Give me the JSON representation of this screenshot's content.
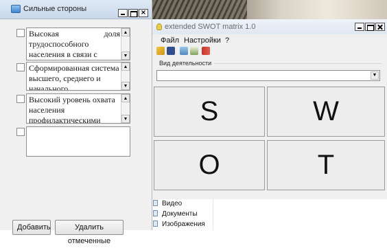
{
  "strengths_window": {
    "title": "Сильные стороны",
    "items": [
      {
        "text": "Высокая доля трудоспособного населения в связи с"
      },
      {
        "text": "Сформированная система высшего, среднего и начального"
      },
      {
        "text": "Высокий уровень охвата населения профилактическими"
      },
      {
        "text": ""
      }
    ],
    "buttons": {
      "add": "Добавить",
      "delete_selected": "Удалить отмеченные"
    }
  },
  "swot_window": {
    "title": "extended SWOT  matrix 1.0",
    "menu": [
      "Файл",
      "Настройки",
      "?"
    ],
    "activity_label": "Вид деятельности",
    "activity_value": "",
    "cells": {
      "s": "S",
      "w": "W",
      "o": "O",
      "t": "T"
    },
    "file_list": [
      "Видео",
      "Документы",
      "Изображения"
    ]
  },
  "colors": {
    "title_gradient_top": "#dfe9f5",
    "cell_bg": "#ededed",
    "window_bg": "#f0f0f0"
  }
}
